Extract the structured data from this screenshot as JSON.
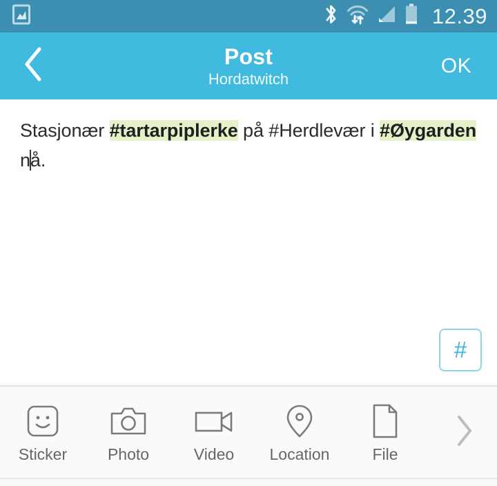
{
  "status_bar": {
    "background": "#3c8fb0",
    "left_icons": [
      {
        "name": "image-capture-icon",
        "label": "screenshot"
      }
    ],
    "right_icons": [
      {
        "name": "bluetooth-icon",
        "label": "bluetooth"
      },
      {
        "name": "wifi-transfer-icon",
        "label": "wifi-data-transfer"
      },
      {
        "name": "signal-strength-icon",
        "label": "cellular-signal"
      },
      {
        "name": "battery-icon",
        "label": "battery"
      }
    ],
    "clock": "12.39"
  },
  "header": {
    "background": "#40badf",
    "back_icon": "chevron-left-icon",
    "title": "Post",
    "subtitle": "Hordatwitch",
    "confirm_label": "OK"
  },
  "compose": {
    "segments": [
      {
        "text": "Stasjonær ",
        "highlight": false
      },
      {
        "text": "#tartarpiplerke",
        "highlight": true
      },
      {
        "text": " på #Herdlevær i ",
        "highlight": false
      },
      {
        "text": "#Øygarden",
        "highlight": true
      },
      {
        "text": " n",
        "highlight": false
      },
      {
        "caret": true
      },
      {
        "text": "å.",
        "highlight": false
      }
    ],
    "full_text": "Stasjonær #tartarpiplerke på #Herdlevær i #Øygarden nå.",
    "placeholder": "",
    "highlight_color": "#e5f2c9",
    "text_color": "#2b2b2b"
  },
  "hashtag_button": {
    "label": "#",
    "name": "hashtag-insert-button",
    "border_color": "#8fd3ea",
    "text_color": "#3fb4d8"
  },
  "toolbar": {
    "background": "#fafafa",
    "items": [
      {
        "label": "Sticker",
        "icon": "sticker-smiley-icon"
      },
      {
        "label": "Photo",
        "icon": "camera-icon"
      },
      {
        "label": "Video",
        "icon": "video-camera-icon"
      },
      {
        "label": "Location",
        "icon": "map-pin-icon"
      },
      {
        "label": "File",
        "icon": "file-document-icon"
      }
    ],
    "more_icon": "chevron-right-icon",
    "icon_color": "#7a7a7a",
    "label_color": "#666666"
  }
}
